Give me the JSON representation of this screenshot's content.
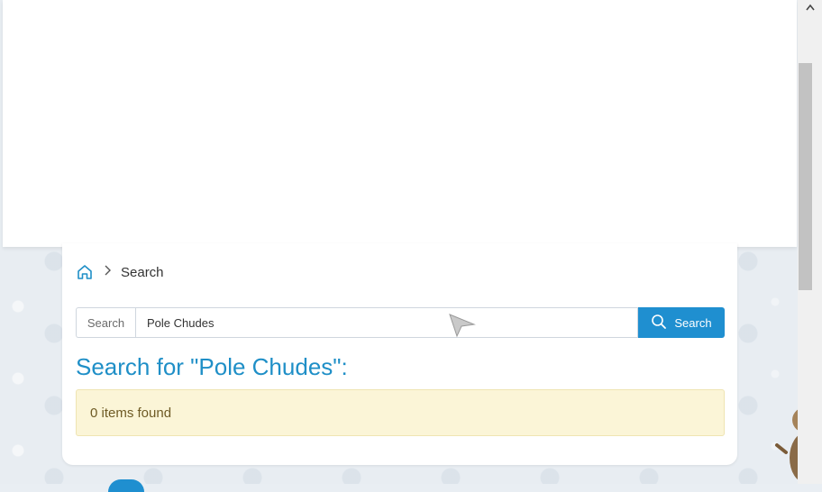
{
  "breadcrumb": {
    "current": "Search"
  },
  "search": {
    "scope_label": "Search",
    "query": "Pole Chudes",
    "button_label": "Search"
  },
  "results": {
    "title": "Search for \"Pole Chudes\":",
    "notice": "0 items found"
  },
  "icons": {
    "home": "home-icon",
    "chevron": "chevron-right-icon",
    "search": "search-icon"
  },
  "colors": {
    "accent": "#1f8fd0",
    "title": "#1f8fc7",
    "notice_bg": "#fbf5d7"
  }
}
